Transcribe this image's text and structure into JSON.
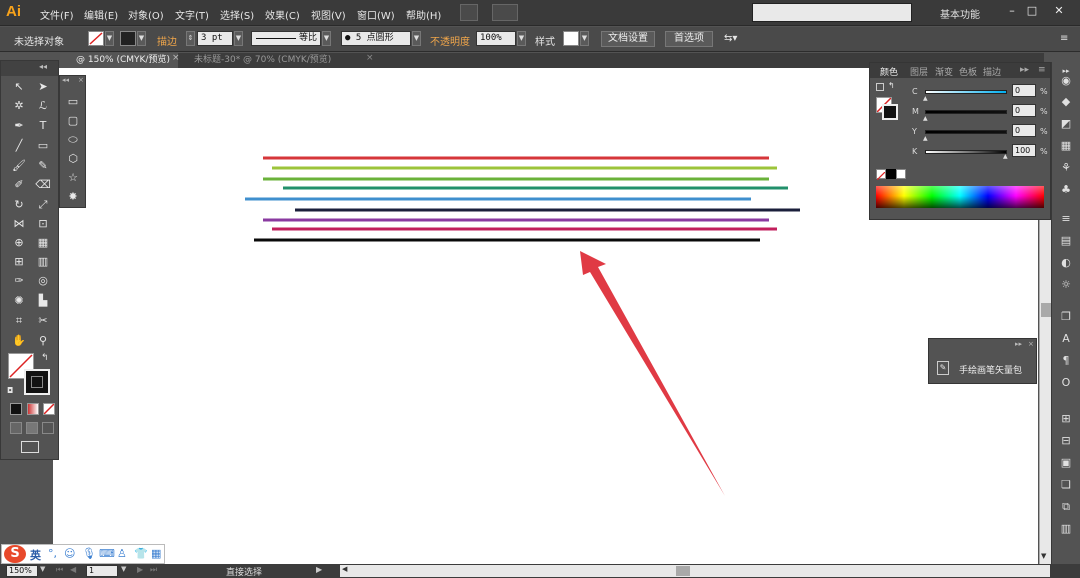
{
  "app": {
    "logo": "Ai"
  },
  "menu": {
    "items": [
      "文件(F)",
      "编辑(E)",
      "对象(O)",
      "文字(T)",
      "选择(S)",
      "效果(C)",
      "视图(V)",
      "窗口(W)",
      "帮助(H)"
    ]
  },
  "workspace": {
    "label": "基本功能"
  },
  "controlbar": {
    "selection_status": "未选择对象",
    "stroke_label": "描边",
    "stroke_weight": "3 pt",
    "profile_label": "等比",
    "brush_label": "● 5 点圆形",
    "opacity_label": "不透明度",
    "opacity_value": "100%",
    "style_label": "样式",
    "doc_setup_button": "文档设置",
    "preferences_button": "首选项"
  },
  "tabs": [
    {
      "label": "@ 150% (CMYK/预览)"
    },
    {
      "label": "未标题-30* @ 70% (CMYK/预览)"
    }
  ],
  "color_panel": {
    "tabs": [
      "颜色",
      "图层",
      "渐变",
      "色板",
      "描边"
    ],
    "sliders": [
      {
        "name": "C",
        "value": "0",
        "unit": "%"
      },
      {
        "name": "M",
        "value": "0",
        "unit": "%"
      },
      {
        "name": "Y",
        "value": "0",
        "unit": "%"
      },
      {
        "name": "K",
        "value": "100",
        "unit": "%"
      }
    ]
  },
  "brush_panel": {
    "item_label": "手绘画笔矢量包"
  },
  "canvas": {
    "line_colors": [
      "#d6363a",
      "#9cc43a",
      "#6ab23a",
      "#22906b",
      "#3f8fce",
      "#1b1f3b",
      "#8a3aa0",
      "#c21f5c",
      "#0a0a0a"
    ],
    "arrow_color": "#e03a44"
  },
  "status": {
    "zoom": "150%",
    "page": "1",
    "tool": "直接选择"
  },
  "ime": {
    "lang": "英"
  }
}
